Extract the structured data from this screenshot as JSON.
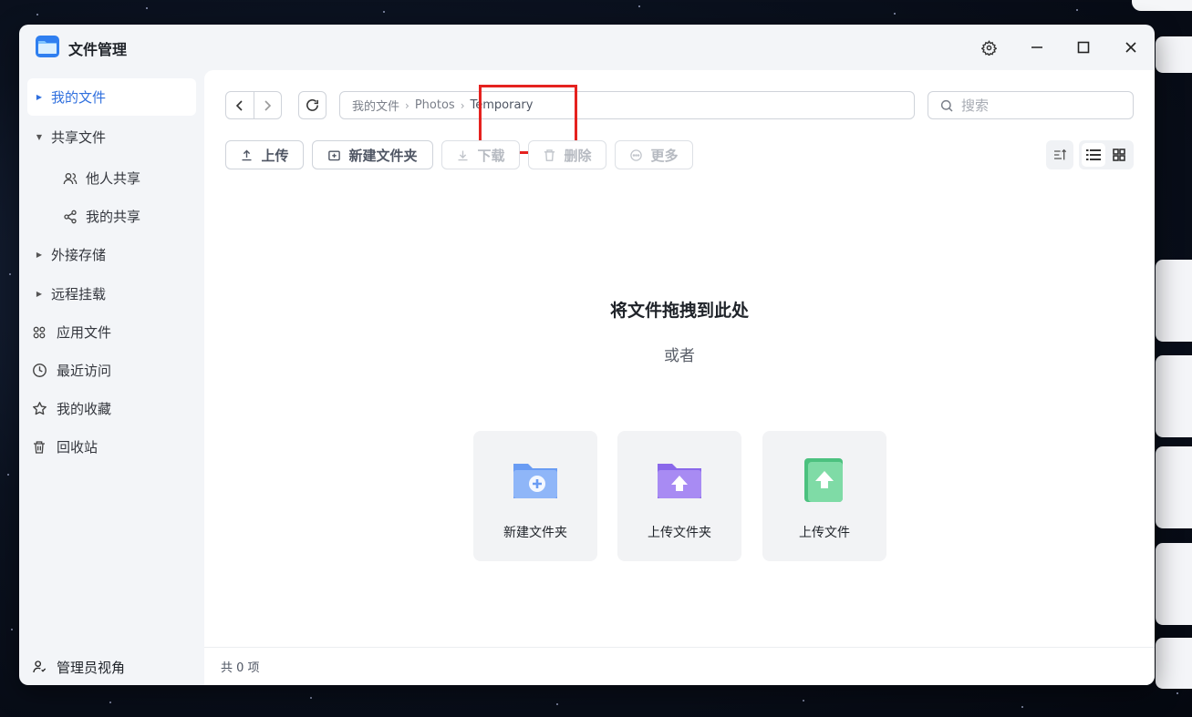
{
  "app": {
    "title": "文件管理",
    "window_controls": [
      "gear-icon",
      "minimize-icon",
      "maximize-icon",
      "close-icon"
    ]
  },
  "sidebar": {
    "items": [
      {
        "label": "我的文件",
        "icon": "caret-right-icon",
        "active": true
      },
      {
        "label": "共享文件",
        "icon": "caret-down-icon"
      },
      {
        "label": "他人共享",
        "icon": "users-icon"
      },
      {
        "label": "我的共享",
        "icon": "share-icon"
      },
      {
        "label": "外接存储",
        "icon": "caret-right-icon"
      },
      {
        "label": "远程挂载",
        "icon": "caret-right-icon"
      },
      {
        "label": "应用文件",
        "icon": "apps-icon"
      },
      {
        "label": "最近访问",
        "icon": "clock-icon"
      },
      {
        "label": "我的收藏",
        "icon": "star-icon"
      },
      {
        "label": "回收站",
        "icon": "trash-icon"
      }
    ],
    "admin_label": "管理员视角"
  },
  "breadcrumb": {
    "items": [
      "我的文件",
      "Photos",
      "Temporary"
    ]
  },
  "search": {
    "placeholder": "搜索"
  },
  "toolbar": {
    "upload": "上传",
    "new_folder": "新建文件夹",
    "download": "下载",
    "delete": "删除",
    "more": "更多"
  },
  "empty_state": {
    "title": "将文件拖拽到此处",
    "or": "或者",
    "cards": [
      {
        "label": "新建文件夹",
        "icon": "folder-plus-icon",
        "color": "#5b8def"
      },
      {
        "label": "上传文件夹",
        "icon": "folder-upload-icon",
        "color": "#8b6cf0"
      },
      {
        "label": "上传文件",
        "icon": "file-upload-icon",
        "color": "#52c98a"
      }
    ]
  },
  "status": {
    "count_text": "共 0 项"
  },
  "colors": {
    "accent": "#2f6fde",
    "highlight": "#e5221f"
  }
}
